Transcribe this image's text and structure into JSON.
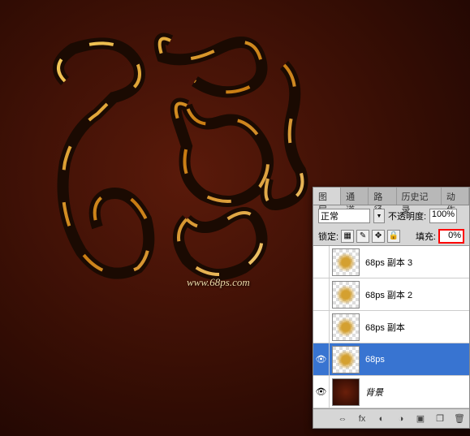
{
  "watermark": "www.68ps.com",
  "panel": {
    "tabs": {
      "layers": "图层",
      "channels": "通道",
      "paths": "路径",
      "history": "历史记录",
      "actions": "动作"
    },
    "blend_mode": "正常",
    "opacity_label": "不透明度:",
    "opacity_value": "100%",
    "lock_label": "锁定:",
    "fill_label": "填充:",
    "fill_value": "0%",
    "layers": [
      {
        "name": "68ps 副本 3",
        "visible": false,
        "thumb": "fu",
        "selected": false
      },
      {
        "name": "68ps 副本 2",
        "visible": false,
        "thumb": "fu",
        "selected": false
      },
      {
        "name": "68ps 副本",
        "visible": false,
        "thumb": "fu",
        "selected": false
      },
      {
        "name": "68ps",
        "visible": true,
        "thumb": "fu",
        "selected": true
      },
      {
        "name": "背景",
        "visible": true,
        "thumb": "bg",
        "selected": false,
        "bg": true
      }
    ]
  }
}
